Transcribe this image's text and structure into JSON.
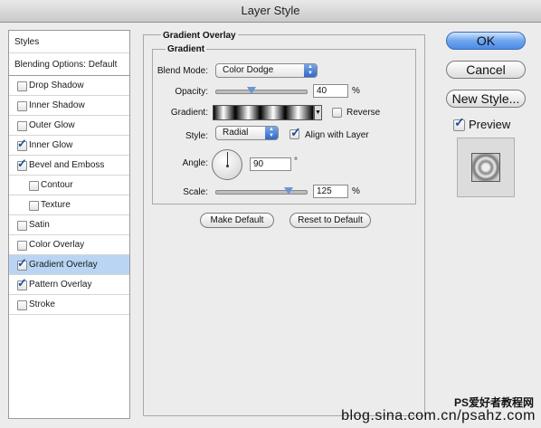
{
  "window": {
    "title": "Layer Style"
  },
  "sidebar": {
    "styles_label": "Styles",
    "blending_label": "Blending Options: Default",
    "items": [
      {
        "label": "Drop Shadow",
        "checked": false
      },
      {
        "label": "Inner Shadow",
        "checked": false
      },
      {
        "label": "Outer Glow",
        "checked": false
      },
      {
        "label": "Inner Glow",
        "checked": true
      },
      {
        "label": "Bevel and Emboss",
        "checked": true
      },
      {
        "label": "Contour",
        "checked": false
      },
      {
        "label": "Texture",
        "checked": false
      },
      {
        "label": "Satin",
        "checked": false
      },
      {
        "label": "Color Overlay",
        "checked": false
      },
      {
        "label": "Gradient Overlay",
        "checked": true
      },
      {
        "label": "Pattern Overlay",
        "checked": true
      },
      {
        "label": "Stroke",
        "checked": false
      }
    ],
    "selected": "Gradient Overlay"
  },
  "panel": {
    "title": "Gradient Overlay",
    "group_title": "Gradient",
    "blend_mode_label": "Blend Mode:",
    "blend_mode_value": "Color Dodge",
    "opacity_label": "Opacity:",
    "opacity_value": "40",
    "opacity_unit": "%",
    "opacity_level": 0.4,
    "gradient_label": "Gradient:",
    "reverse_label": "Reverse",
    "reverse_checked": false,
    "style_label": "Style:",
    "style_value": "Radial",
    "align_label": "Align with Layer",
    "align_checked": true,
    "angle_label": "Angle:",
    "angle_value": "90",
    "angle_unit": "°",
    "scale_label": "Scale:",
    "scale_value": "125",
    "scale_unit": "%",
    "make_default_label": "Make Default",
    "reset_default_label": "Reset to Default"
  },
  "buttons": {
    "ok_label": "OK",
    "cancel_label": "Cancel",
    "new_style_label": "New Style...",
    "preview_label": "Preview",
    "preview_checked": true
  },
  "watermark": {
    "line1": "PS爱好者教程网",
    "line2": "blog.sina.com.cn/psahz.com"
  },
  "colors": {
    "accent": "#4b8ae6",
    "selected_row": "#b9d5f3"
  }
}
